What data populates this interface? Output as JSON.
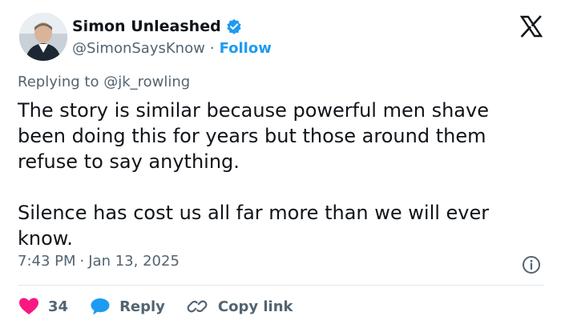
{
  "author": {
    "display_name": "Simon Unleashed",
    "handle": "@SimonSaysKnow",
    "separator": "·",
    "follow_label": "Follow",
    "verified_icon": "verified-badge-icon"
  },
  "reply": {
    "prefix": "Replying to ",
    "mention": "@jk_rowling"
  },
  "tweet": {
    "text": "The story is similar because powerful men shave been doing this for years but those around them refuse to say anything.\n\nSilence has cost us all far more than we will ever know."
  },
  "meta": {
    "time": "7:43 PM",
    "sep": "·",
    "date": "Jan 13, 2025"
  },
  "actions": {
    "like_count": "34",
    "reply_label": "Reply",
    "copy_label": "Copy link"
  },
  "colors": {
    "accent": "#1d9bf0",
    "like": "#f91880",
    "muted": "#536471",
    "text": "#0f1419"
  }
}
